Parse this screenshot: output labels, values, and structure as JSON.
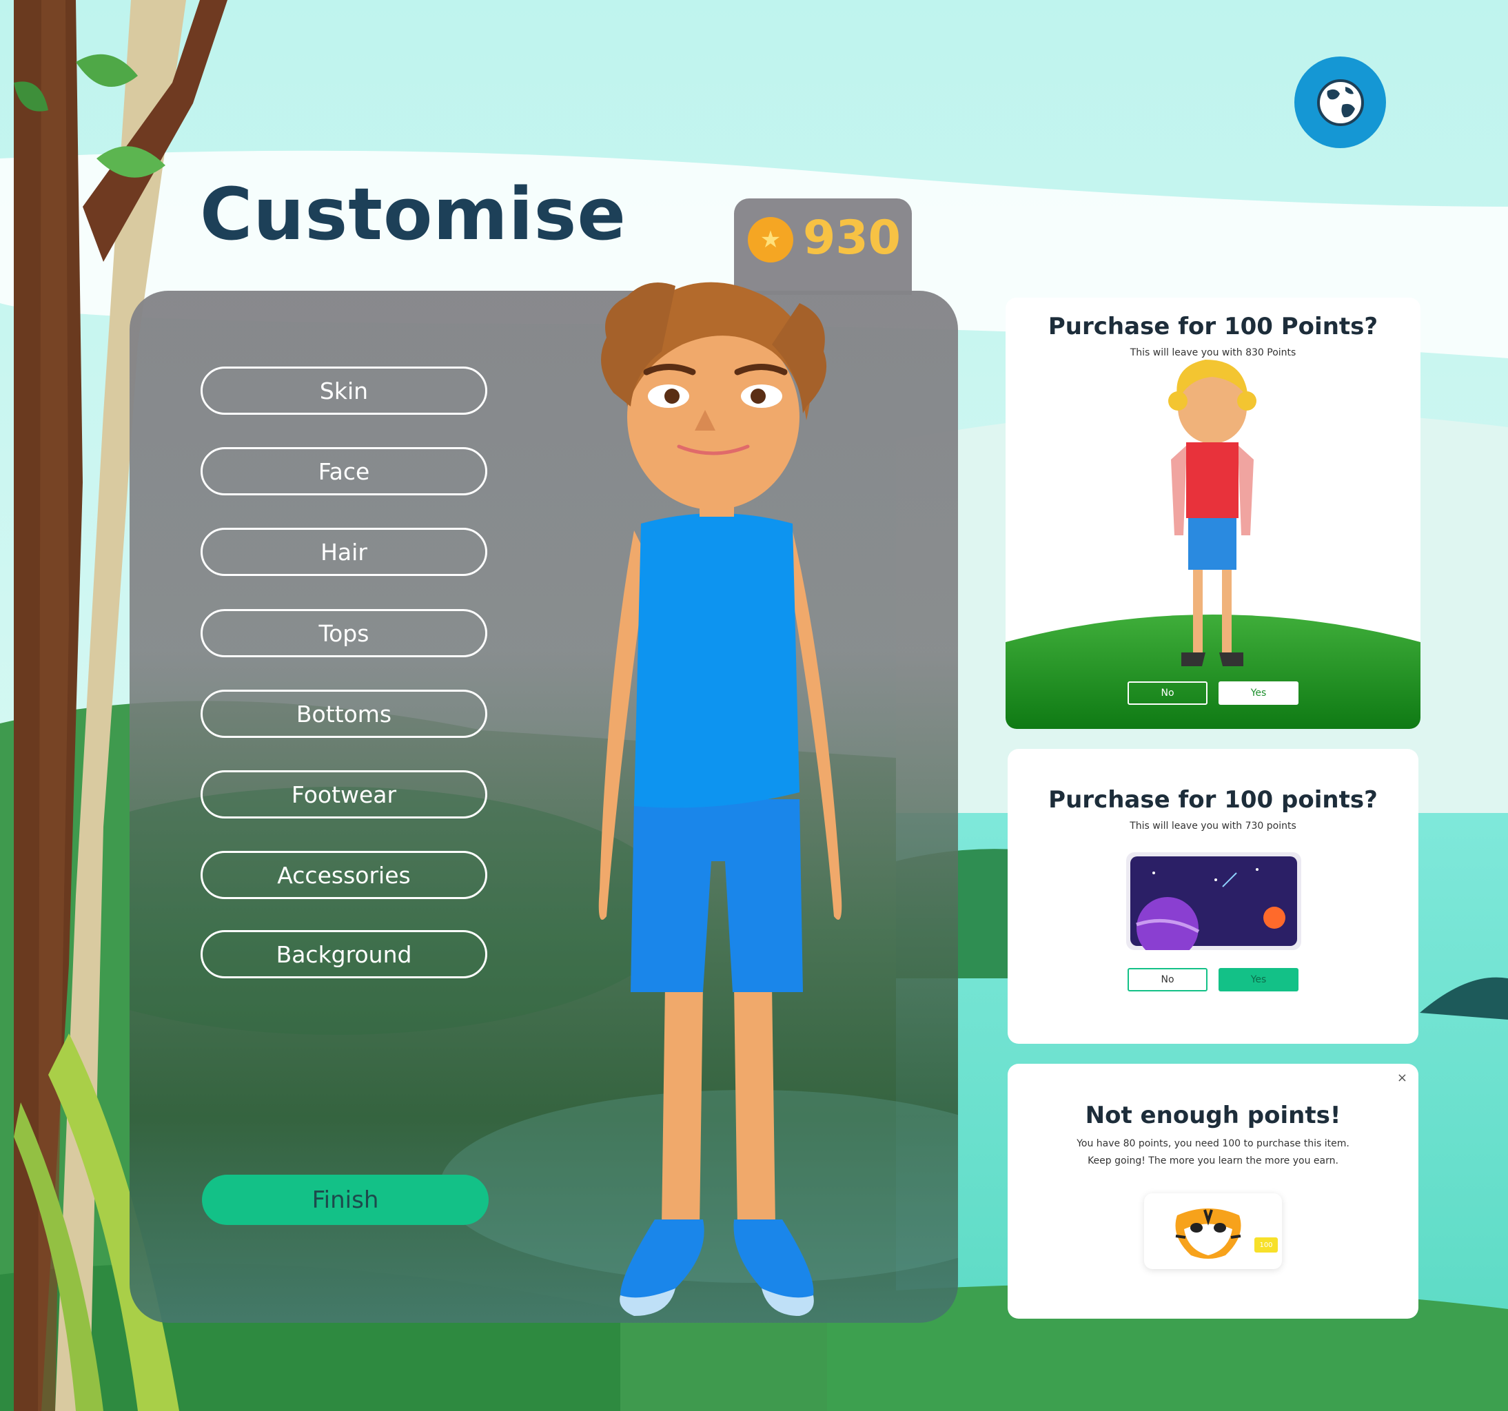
{
  "title": "Customise",
  "points": {
    "value": "930"
  },
  "categories": [
    {
      "label": "Skin"
    },
    {
      "label": "Face"
    },
    {
      "label": "Hair"
    },
    {
      "label": "Tops"
    },
    {
      "label": "Bottoms"
    },
    {
      "label": "Footwear"
    },
    {
      "label": "Accessories"
    },
    {
      "label": "Background"
    }
  ],
  "finish_label": "Finish",
  "dialogs": {
    "purchase_outfit": {
      "title": "Purchase for 100 Points?",
      "subtitle": "This will leave you with 830 Points",
      "no_label": "No",
      "yes_label": "Yes"
    },
    "purchase_background": {
      "title": "Purchase for 100 points?",
      "subtitle": "This will leave you with 730 points",
      "no_label": "No",
      "yes_label": "Yes"
    },
    "not_enough": {
      "title": "Not enough points!",
      "line1": "You have 80 points, you need 100 to purchase this item.",
      "line2": "Keep going! The more you learn the more you earn.",
      "price_tag": "100",
      "close": "×"
    }
  },
  "colors": {
    "accent_blue": "#1597d4",
    "finish_green": "#13c187",
    "title_navy": "#1d4058",
    "points_gold": "#f7c244"
  }
}
